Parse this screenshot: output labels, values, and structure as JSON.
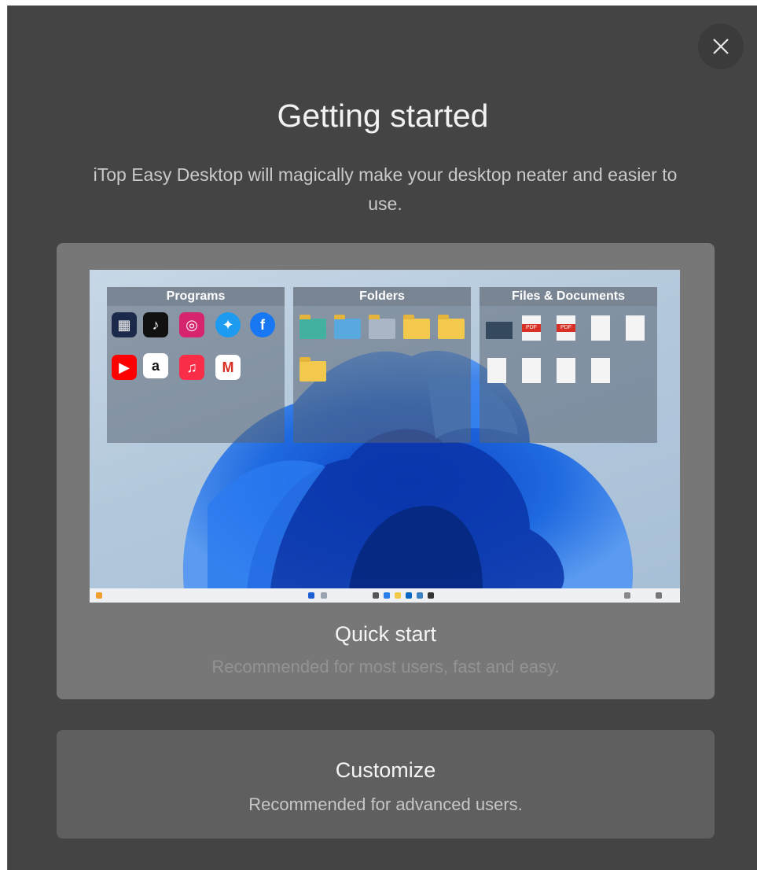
{
  "dialog": {
    "title": "Getting started",
    "subtitle": "iTop Easy Desktop will magically make your desktop neater and easier to use.",
    "close_icon": "close-icon"
  },
  "preview": {
    "panels": [
      {
        "label": "Programs"
      },
      {
        "label": "Folders"
      },
      {
        "label": "Files & Documents"
      }
    ]
  },
  "options": {
    "quick_start": {
      "title": "Quick start",
      "description": "Recommended for most users, fast and easy."
    },
    "customize": {
      "title": "Customize",
      "description": "Recommended for advanced users."
    }
  },
  "colors": {
    "dialog_bg": "#444444",
    "card_quick_bg": "#777777",
    "card_custom_bg": "#5f5f5f",
    "accent_blue": "#1f5fd6"
  }
}
